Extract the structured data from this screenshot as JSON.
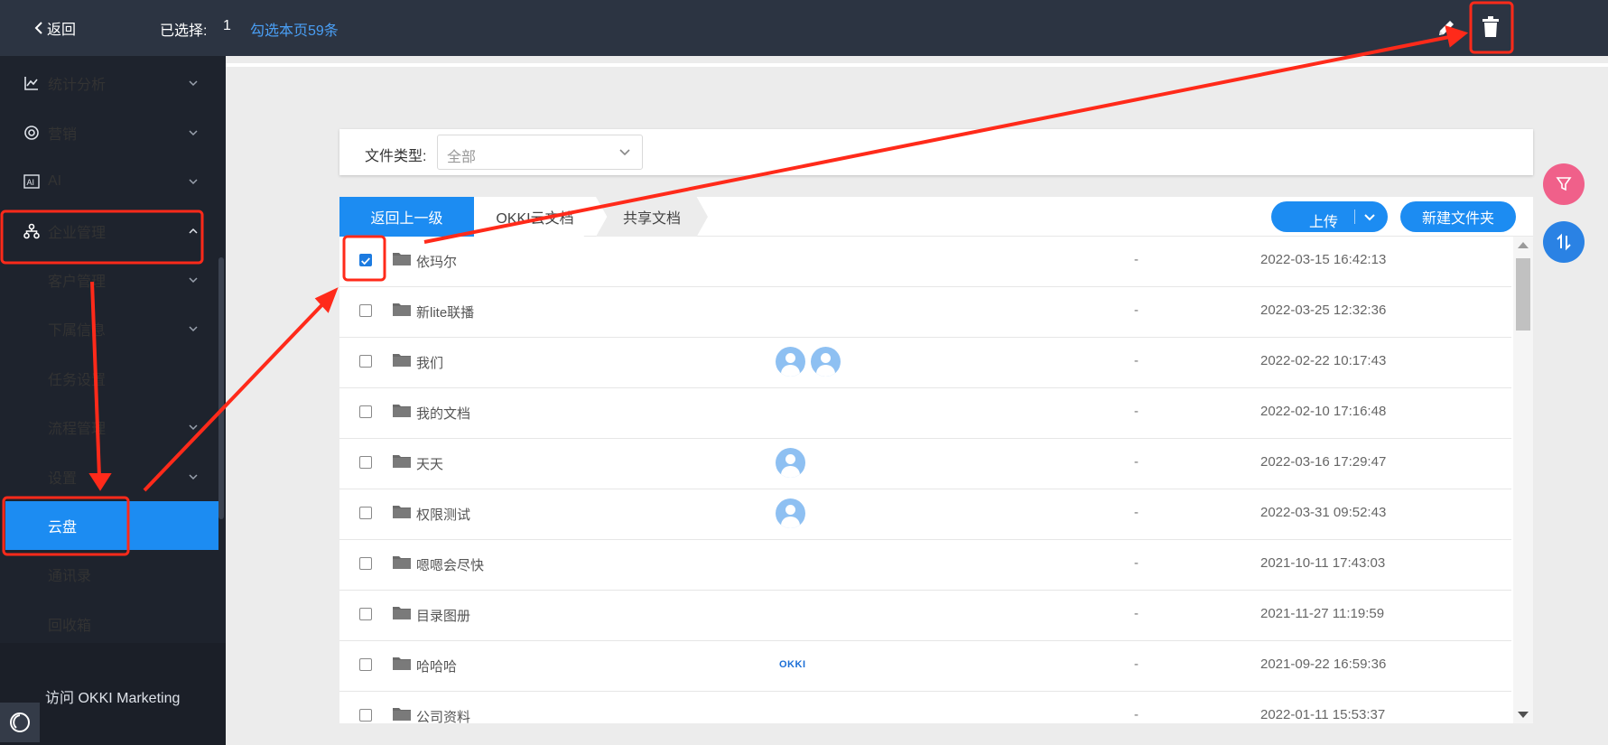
{
  "topbar": {
    "back_label": "返回",
    "selected_label": "已选择:",
    "selected_count": "1",
    "select_page_label": "勾选本页59条"
  },
  "sidebar": {
    "items": [
      {
        "label": "统计分析",
        "icon": "chart-line-icon",
        "has_arrow": true
      },
      {
        "label": "营销",
        "icon": "target-icon",
        "has_arrow": true
      },
      {
        "label": "AI",
        "icon": "ai-icon",
        "has_arrow": true
      },
      {
        "label": "企业管理",
        "icon": "org-tree-icon",
        "has_arrow": true,
        "expanded": true
      },
      {
        "label": "客户管理",
        "sub": true,
        "has_arrow": true
      },
      {
        "label": "下属信息",
        "sub": true,
        "has_arrow": true
      },
      {
        "label": "任务设置",
        "sub": true,
        "has_arrow": false
      },
      {
        "label": "流程管理",
        "sub": true,
        "has_arrow": true
      },
      {
        "label": "设置",
        "sub": true,
        "has_arrow": true
      },
      {
        "label": "云盘",
        "sub": true,
        "active": true
      },
      {
        "label": "通讯录",
        "sub": true
      },
      {
        "label": "回收箱",
        "sub": true
      }
    ],
    "visit_label": "访问 OKKI Marketing"
  },
  "filter": {
    "label": "文件类型:",
    "value": "全部"
  },
  "toolbar": {
    "back_up_label": "返回上一级",
    "crumbs": [
      "OKKI云文档",
      "共享文档"
    ],
    "upload_label": "上传",
    "new_folder_label": "新建文件夹"
  },
  "files": [
    {
      "name": "依玛尔",
      "avatars": 0,
      "size": "-",
      "date": "2022-03-15 16:42:13",
      "checked": true
    },
    {
      "name": "新lite联播",
      "avatars": 0,
      "size": "-",
      "date": "2022-03-25 12:32:36",
      "checked": false
    },
    {
      "name": "我们",
      "avatars": 2,
      "size": "-",
      "date": "2022-02-22 10:17:43",
      "checked": false
    },
    {
      "name": "我的文档",
      "avatars": 0,
      "size": "-",
      "date": "2022-02-10 17:16:48",
      "checked": false
    },
    {
      "name": "天天",
      "avatars": 1,
      "size": "-",
      "date": "2022-03-16 17:29:47",
      "checked": false
    },
    {
      "name": "权限测试",
      "avatars": 1,
      "size": "-",
      "date": "2022-03-31 09:52:43",
      "checked": false
    },
    {
      "name": "嗯嗯会尽快",
      "avatars": 0,
      "size": "-",
      "date": "2021-10-11 17:43:03",
      "checked": false
    },
    {
      "name": "目录图册",
      "avatars": 0,
      "size": "-",
      "date": "2021-11-27 11:19:59",
      "checked": false
    },
    {
      "name": "哈哈哈",
      "avatars": 0,
      "logo": "OKKI",
      "size": "-",
      "date": "2021-09-22 16:59:36",
      "checked": false
    },
    {
      "name": "公司资料",
      "avatars": 0,
      "size": "-",
      "date": "2022-01-11 15:53:37",
      "checked": false
    }
  ],
  "colors": {
    "accent": "#1c8cf2",
    "topbar": "#2c3442",
    "sidebar": "#1e232d",
    "annotation": "#ff2a1a",
    "filter_fab": "#f0608a",
    "sort_fab": "#2a82e4"
  }
}
